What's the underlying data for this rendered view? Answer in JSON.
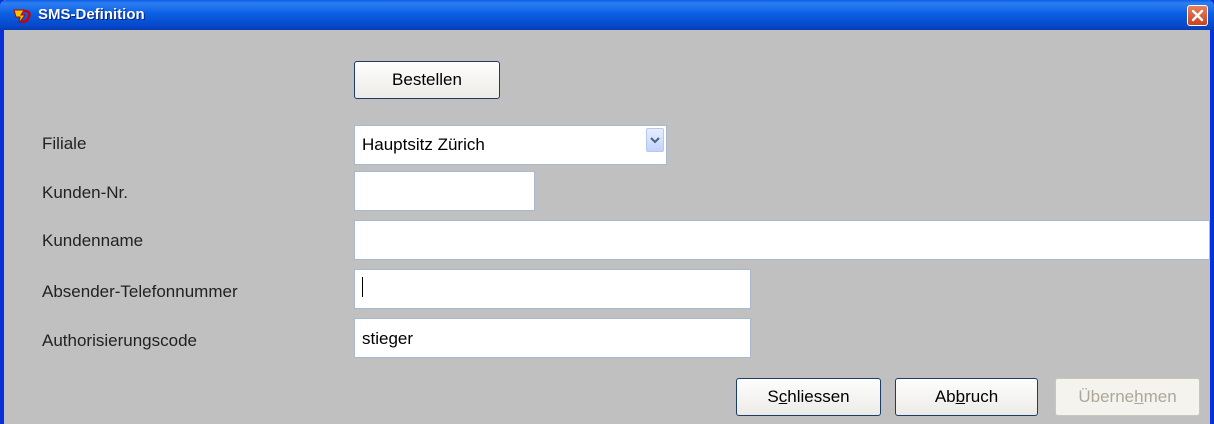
{
  "window": {
    "title": "SMS-Definition",
    "icons": {
      "app": "app-logo-icon",
      "close": "close-icon"
    }
  },
  "buttons": {
    "order": "Bestellen",
    "close": {
      "before": "S",
      "mnemonic": "c",
      "after": "hliessen"
    },
    "cancel": {
      "before": "Ab",
      "mnemonic": "b",
      "after": "ruch"
    },
    "apply": {
      "before": "Überne",
      "mnemonic": "h",
      "after": "men"
    }
  },
  "form": {
    "branch": {
      "label": "Filiale",
      "value": "Hauptsitz Zürich"
    },
    "customer_number": {
      "label": "Kunden-Nr.",
      "value": ""
    },
    "customer_name": {
      "label": "Kundenname",
      "value": ""
    },
    "sender_phone": {
      "label": "Absender-Telefonnummer",
      "value": ""
    },
    "auth_code": {
      "label": "Authorisierungscode",
      "value": "stieger"
    }
  },
  "colors": {
    "titlebar": "#0a5ce6",
    "window_bg": "#c0c0c0",
    "close_button": "#d5572f"
  }
}
